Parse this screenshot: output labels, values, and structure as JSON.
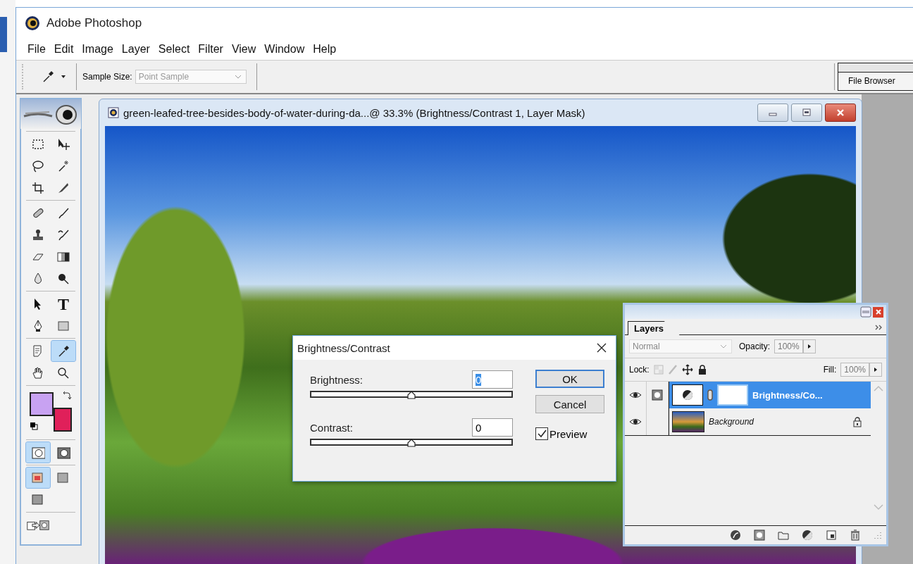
{
  "app": {
    "title": "Adobe Photoshop"
  },
  "menu": [
    "File",
    "Edit",
    "Image",
    "Layer",
    "Select",
    "Filter",
    "View",
    "Window",
    "Help"
  ],
  "options_bar": {
    "sample_size_label": "Sample Size:",
    "sample_size": "Point Sample",
    "palette_tab": "File Browser"
  },
  "toolbox": {
    "groups": [
      [
        {
          "kind": "marquee",
          "selected": false
        },
        {
          "kind": "move",
          "selected": false
        },
        {
          "kind": "lasso",
          "selected": false
        },
        {
          "kind": "wand",
          "selected": false
        },
        {
          "kind": "crop",
          "selected": false
        },
        {
          "kind": "slice",
          "selected": false
        }
      ],
      [
        {
          "kind": "healing",
          "selected": false
        },
        {
          "kind": "brush",
          "selected": false
        },
        {
          "kind": "stamp",
          "selected": false
        },
        {
          "kind": "history-brush",
          "selected": false
        },
        {
          "kind": "eraser",
          "selected": false
        },
        {
          "kind": "gradient",
          "selected": false
        },
        {
          "kind": "blur",
          "selected": false
        },
        {
          "kind": "dodge",
          "selected": false
        }
      ],
      [
        {
          "kind": "path-select",
          "selected": false
        },
        {
          "kind": "type",
          "glyph": "T",
          "selected": false
        },
        {
          "kind": "pen",
          "selected": false
        },
        {
          "kind": "shape",
          "selected": false
        }
      ],
      [
        {
          "kind": "notes",
          "selected": false
        },
        {
          "kind": "eyedropper",
          "selected": true
        },
        {
          "kind": "hand",
          "selected": false
        },
        {
          "kind": "zoom",
          "selected": false
        }
      ]
    ],
    "swatches": [
      {
        "kind": "foreground",
        "color": "#c8a2f2"
      },
      {
        "kind": "background",
        "color": "#e0205a"
      }
    ],
    "mode_groups": [
      [
        {
          "kind": "standard-mode",
          "selected": true
        },
        {
          "kind": "quick-mask",
          "selected": false
        }
      ],
      [
        {
          "kind": "screen-standard",
          "selected": true
        },
        {
          "kind": "screen-menu",
          "selected": false
        },
        {
          "kind": "screen-full",
          "selected": false
        }
      ],
      [
        {
          "kind": "jump",
          "selected": false
        }
      ]
    ]
  },
  "document": {
    "title": "green-leafed-tree-besides-body-of-water-during-da...@ 33.3% (Brightness/Contrast 1, Layer Mask)"
  },
  "dialog": {
    "title": "Brightness/Contrast",
    "adjustments": [
      {
        "label": "Brightness:",
        "value": "0",
        "selected": true,
        "level": 0.5
      },
      {
        "label": "Contrast:",
        "value": "0",
        "selected": false,
        "level": 0.5
      }
    ],
    "buttons": [
      {
        "label": "OK",
        "default": true
      },
      {
        "label": "Cancel",
        "default": false
      }
    ],
    "preview": {
      "label": "Preview",
      "checked": true
    }
  },
  "layers_panel": {
    "tab": "Layers",
    "blend_mode": "Normal",
    "opacity_label": "Opacity:",
    "opacity": "100%",
    "lock_label": "Lock:",
    "fill_label": "Fill:",
    "fill": "100%",
    "layers": [
      {
        "name": "Brightness/Co...",
        "kind": "adjustment",
        "visible": true,
        "selected": true,
        "locked": false
      },
      {
        "name": "Background",
        "kind": "image",
        "visible": true,
        "selected": false,
        "locked": true
      }
    ]
  }
}
